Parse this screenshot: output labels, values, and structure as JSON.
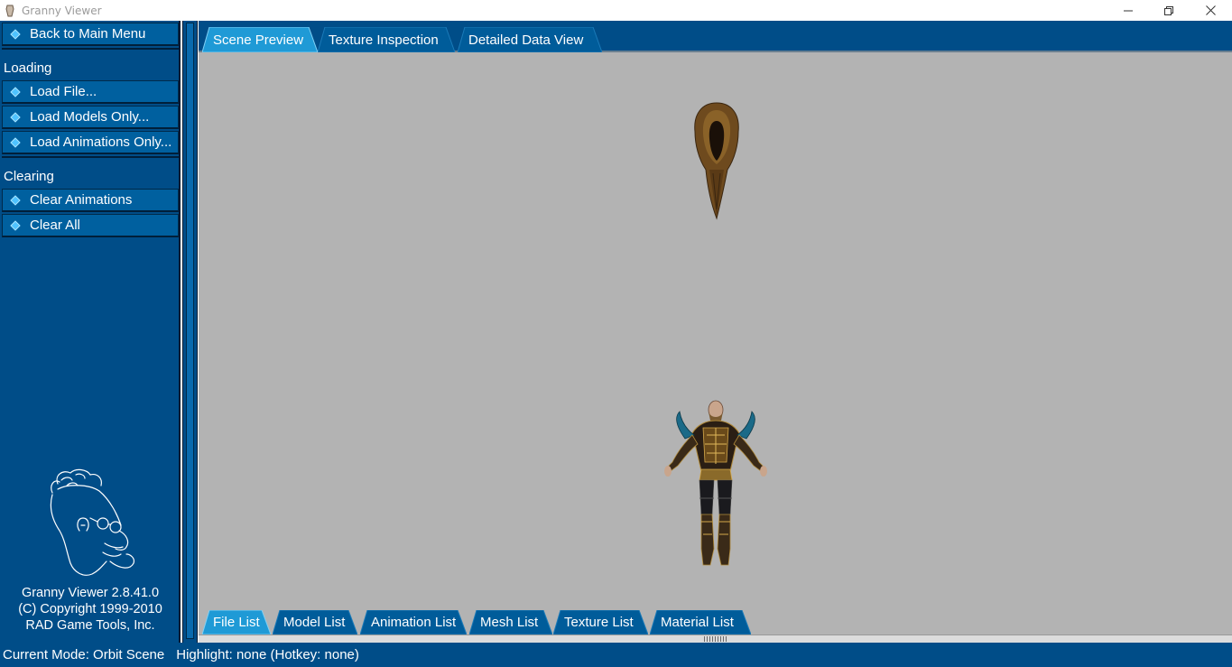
{
  "window": {
    "title": "Granny Viewer"
  },
  "sidebar": {
    "back_label": "Back to Main Menu",
    "loading_label": "Loading",
    "load_file_label": "Load File...",
    "load_models_label": "Load Models Only...",
    "load_animations_label": "Load Animations Only...",
    "clearing_label": "Clearing",
    "clear_animations_label": "Clear Animations",
    "clear_all_label": "Clear All",
    "about": {
      "version": "Granny Viewer 2.8.41.0",
      "copyright": "(C) Copyright 1999-2010",
      "company": "RAD Game Tools, Inc."
    }
  },
  "top_tabs": {
    "scene_preview": "Scene Preview",
    "texture_inspection": "Texture Inspection",
    "detailed_data_view": "Detailed Data View",
    "active": "Scene Preview"
  },
  "bottom_tabs": {
    "file_list": "File List",
    "model_list": "Model List",
    "animation_list": "Animation List",
    "mesh_list": "Mesh List",
    "texture_list": "Texture List",
    "material_list": "Material List",
    "active": "File List"
  },
  "status": {
    "mode": "Current Mode: Orbit Scene",
    "highlight": "Highlight: none (Hotkey: none)"
  },
  "colors": {
    "panel_blue": "#004d88",
    "button_blue": "#00609f",
    "active_tab": "#1f9ad6",
    "viewport_gray": "#b3b3b3",
    "diamond": "#4fc3ff"
  }
}
